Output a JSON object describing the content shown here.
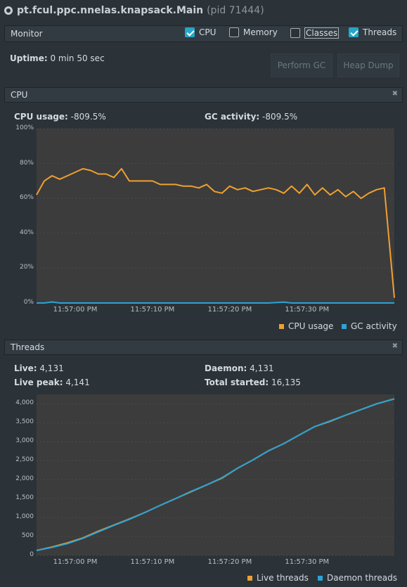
{
  "titlebar": {
    "app_name": "pt.fcul.ppc.nnelas.knapsack.Main",
    "pid": "(pid 71444)"
  },
  "monitor": {
    "title": "Monitor",
    "checkboxes": [
      {
        "label": "CPU",
        "checked": true
      },
      {
        "label": "Memory",
        "checked": false
      },
      {
        "label": "Classes",
        "checked": false
      },
      {
        "label": "Threads",
        "checked": true
      }
    ],
    "uptime_label": "Uptime:",
    "uptime_value": "0 min 50 sec",
    "perform_gc": "Perform GC",
    "heap_dump": "Heap Dump"
  },
  "cpu_panel": {
    "title": "CPU",
    "cpu_usage_label": "CPU usage:",
    "cpu_usage_value": "-809.5%",
    "gc_activity_label": "GC activity:",
    "gc_activity_value": "-809.5%"
  },
  "threads_panel": {
    "title": "Threads",
    "live_label": "Live:",
    "live_value": "4,131",
    "live_peak_label": "Live peak:",
    "live_peak_value": "4,141",
    "daemon_label": "Daemon:",
    "daemon_value": "4,131",
    "total_started_label": "Total started:",
    "total_started_value": "16,135"
  },
  "colors": {
    "orange": "#f0a030",
    "blue": "#2ba3d6",
    "plot_bg": "#3c3c3c"
  },
  "chart_data": [
    {
      "type": "line",
      "y_tick_labels": [
        "100%",
        "80%",
        "60%",
        "40%",
        "20%",
        "0%"
      ],
      "y_ticks": [
        100,
        80,
        60,
        40,
        20,
        0
      ],
      "ylim": [
        0,
        100
      ],
      "x_tick_labels": [
        "11:57:00 PM",
        "11:57:10 PM",
        "11:57:20 PM",
        "11:57:30 PM"
      ],
      "x_ticks": [
        5,
        15,
        25,
        35
      ],
      "xlim": [
        0,
        46.3
      ],
      "series": [
        {
          "name": "CPU usage",
          "color": "#f0a030",
          "x": [
            0,
            1,
            2,
            3,
            4,
            5,
            6,
            7,
            8,
            9,
            10,
            11,
            12,
            13,
            14,
            15,
            16,
            17,
            18,
            19,
            20,
            21,
            22,
            23,
            24,
            25,
            26,
            27,
            28,
            29,
            30,
            31,
            32,
            33,
            34,
            35,
            36,
            37,
            38,
            39,
            40,
            41,
            42,
            43,
            44,
            45,
            46.3
          ],
          "values": [
            62,
            70,
            73,
            71,
            73,
            75,
            77,
            76,
            74,
            74,
            72,
            77,
            70,
            70,
            70,
            70,
            68,
            68,
            68,
            67,
            67,
            66,
            68,
            64,
            63,
            67,
            65,
            66,
            64,
            65,
            66,
            65,
            63,
            67,
            63,
            68,
            62,
            66,
            62,
            65,
            61,
            64,
            60,
            63,
            65,
            66,
            3
          ]
        },
        {
          "name": "GC activity",
          "color": "#2ba3d6",
          "x": [
            0,
            1,
            2,
            3,
            30,
            32,
            33,
            46.3
          ],
          "values": [
            0,
            0,
            0.6,
            0,
            0,
            0.5,
            0,
            0
          ]
        }
      ],
      "legend": "bottom-right"
    },
    {
      "type": "line",
      "y_tick_labels": [
        "4,000",
        "3,500",
        "3,000",
        "2,500",
        "2,000",
        "1,500",
        "1,000",
        "500",
        "0"
      ],
      "y_ticks": [
        4000,
        3500,
        3000,
        2500,
        2000,
        1500,
        1000,
        500,
        0
      ],
      "ylim": [
        0,
        4250
      ],
      "x_tick_labels": [
        "11:57:00 PM",
        "11:57:10 PM",
        "11:57:20 PM",
        "11:57:30 PM"
      ],
      "x_ticks": [
        5,
        15,
        25,
        35
      ],
      "xlim": [
        0,
        46.3
      ],
      "series": [
        {
          "name": "Live threads",
          "color": "#f0a030",
          "x": [
            0,
            2,
            4,
            6,
            8,
            10,
            12,
            14,
            16,
            18,
            20,
            22,
            24,
            26,
            28,
            30,
            32,
            34,
            36,
            38,
            40,
            42,
            44,
            46.3
          ],
          "values": [
            130,
            220,
            330,
            460,
            640,
            800,
            960,
            1130,
            1320,
            1500,
            1680,
            1860,
            2040,
            2300,
            2520,
            2760,
            2950,
            3180,
            3400,
            3540,
            3700,
            3850,
            4000,
            4131
          ]
        },
        {
          "name": "Daemon threads",
          "color": "#2ba3d6",
          "x": [
            0,
            2,
            4,
            6,
            8,
            10,
            12,
            14,
            16,
            18,
            20,
            22,
            24,
            26,
            28,
            30,
            32,
            34,
            36,
            38,
            40,
            42,
            44,
            46.3
          ],
          "values": [
            130,
            210,
            310,
            450,
            620,
            790,
            950,
            1130,
            1320,
            1500,
            1690,
            1860,
            2050,
            2300,
            2520,
            2760,
            2950,
            3180,
            3400,
            3550,
            3700,
            3850,
            4000,
            4131
          ]
        }
      ],
      "legend": "bottom-right"
    }
  ]
}
